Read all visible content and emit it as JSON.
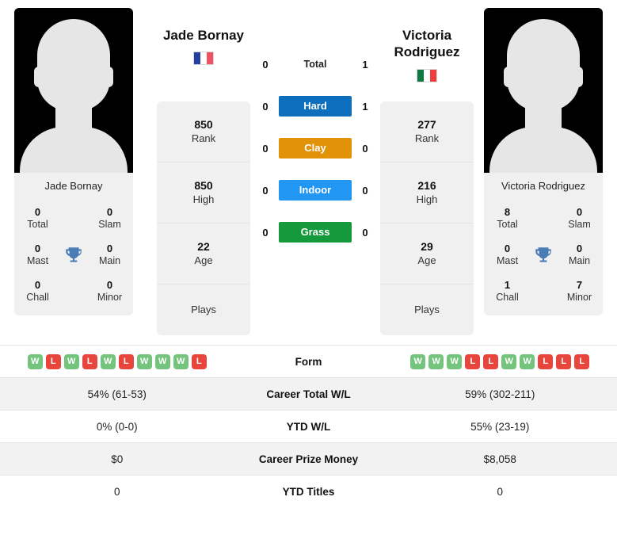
{
  "players": {
    "left": {
      "name": "Jade Bornay",
      "name_wraps": false,
      "photo_name": "Jade Bornay",
      "flag_name": "france-flag",
      "flag_colors": [
        "#2340a0",
        "#ffffff",
        "#ee5263"
      ],
      "stats": [
        {
          "value": "850",
          "label": "Rank"
        },
        {
          "value": "850",
          "label": "High"
        },
        {
          "value": "22",
          "label": "Age"
        }
      ],
      "plays_label": "Plays",
      "plays_value": "",
      "titles": [
        {
          "value": "0",
          "label": "Total"
        },
        {
          "value": "0",
          "label": "Slam"
        },
        {
          "value": "0",
          "label": "Mast"
        },
        {
          "value": "0",
          "label": "Main"
        },
        {
          "value": "0",
          "label": "Chall"
        },
        {
          "value": "0",
          "label": "Minor"
        }
      ],
      "form": [
        "W",
        "L",
        "W",
        "L",
        "W",
        "L",
        "W",
        "W",
        "W",
        "L"
      ],
      "career_total_wl": "54% (61-53)",
      "ytd_wl": "0% (0-0)",
      "career_prize_money": "$0",
      "ytd_titles": "0"
    },
    "right": {
      "name": "Victoria Rodriguez",
      "name_wraps": true,
      "photo_name": "Victoria Rodriguez",
      "flag_name": "mexico-flag",
      "flag_colors": [
        "#10793f",
        "#ffffff",
        "#ee3e3e"
      ],
      "stats": [
        {
          "value": "277",
          "label": "Rank"
        },
        {
          "value": "216",
          "label": "High"
        },
        {
          "value": "29",
          "label": "Age"
        }
      ],
      "plays_label": "Plays",
      "plays_value": "",
      "titles": [
        {
          "value": "8",
          "label": "Total"
        },
        {
          "value": "0",
          "label": "Slam"
        },
        {
          "value": "0",
          "label": "Mast"
        },
        {
          "value": "0",
          "label": "Main"
        },
        {
          "value": "1",
          "label": "Chall"
        },
        {
          "value": "7",
          "label": "Minor"
        }
      ],
      "form": [
        "W",
        "W",
        "W",
        "L",
        "L",
        "W",
        "W",
        "L",
        "L",
        "L"
      ],
      "career_total_wl": "59% (302-211)",
      "ytd_wl": "55% (23-19)",
      "career_prize_money": "$8,058",
      "ytd_titles": "0"
    }
  },
  "head_to_head": [
    {
      "label": "Total",
      "left": "0",
      "right": "1",
      "color": "",
      "text_color": "#222222",
      "filled": false
    },
    {
      "label": "Hard",
      "left": "0",
      "right": "1",
      "color": "#0d6ebd",
      "text_color": "#ffffff",
      "filled": true
    },
    {
      "label": "Clay",
      "left": "0",
      "right": "0",
      "color": "#e29206",
      "text_color": "#ffffff",
      "filled": true
    },
    {
      "label": "Indoor",
      "left": "0",
      "right": "0",
      "color": "#2196f3",
      "text_color": "#ffffff",
      "filled": true
    },
    {
      "label": "Grass",
      "left": "0",
      "right": "0",
      "color": "#149a3c",
      "text_color": "#ffffff",
      "filled": true
    }
  ],
  "table_rows": [
    {
      "label": "Form",
      "type": "form"
    },
    {
      "label": "Career Total W/L",
      "type": "text",
      "key": "career_total_wl"
    },
    {
      "label": "YTD W/L",
      "type": "text",
      "key": "ytd_wl"
    },
    {
      "label": "Career Prize Money",
      "type": "text",
      "key": "career_prize_money"
    },
    {
      "label": "YTD Titles",
      "type": "text",
      "key": "ytd_titles"
    }
  ],
  "icons": {
    "trophy": "trophy-icon"
  },
  "colors": {
    "win": "#74c47d",
    "loss": "#e8463c",
    "card_bg": "#f0f0f0",
    "row_alt_bg": "#f2f2f2"
  }
}
